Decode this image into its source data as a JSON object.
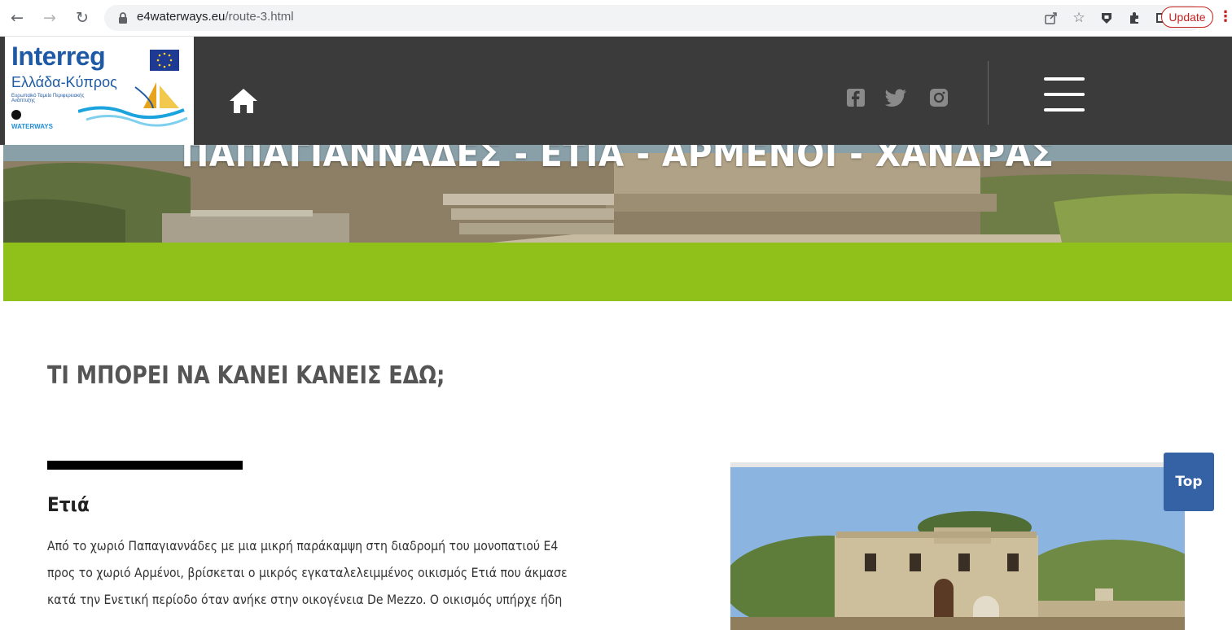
{
  "browser": {
    "url_host": "e4waterways.eu",
    "url_path": "/route-3.html",
    "update_label": "Update"
  },
  "header": {
    "logo": {
      "title": "Interreg",
      "subtitle": "Ελλάδα-Κύπρος",
      "small_text": "Ευρωπαϊκό Ταμείο Περιφερειακής Ανάπτυξης",
      "project": "WATERWAYS"
    },
    "social": [
      "facebook-icon",
      "twitter-icon",
      "instagram-icon"
    ]
  },
  "hero": {
    "title": "ΠΑΠΑΓΙΑΝΝΑΔΕΣ - ΕΤΙΑ - ΑΡΜΕΝΟΙ - ΧΑΝΔΡΑΣ"
  },
  "content": {
    "section_heading": "ΤΙ ΜΠΟΡΕΙ ΝΑ ΚΑΝΕΙ ΚΑΝΕΙΣ ΕΔΩ;",
    "place_title": "Ετιά",
    "paragraph_lines": [
      "Από το χωριό Παπαγιαννάδες με μια μικρή παράκαμψη στη διαδρομή του μονοπατιού Ε4",
      "προς το χωριό Αρμένοι, βρίσκεται ο μικρός εγκαταλελειμμένος οικισμός Ετιά που άκμασε",
      "κατά την Ενετική περίοδο όταν ανήκε στην οικογένεια De Mezzo. Ο οικισμός υπήρχε ήδη"
    ]
  },
  "top_button_label": "Top",
  "colors": {
    "header_bg": "#3b3b3b",
    "green_band": "#90c11a",
    "top_button": "#3561a5",
    "heading": "#555555"
  }
}
